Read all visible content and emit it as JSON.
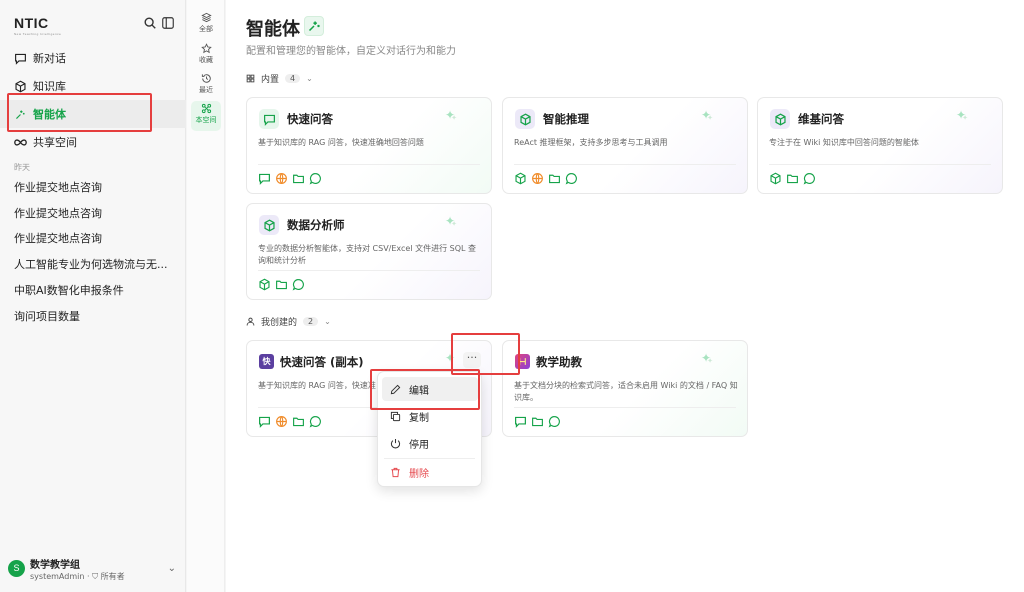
{
  "app": {
    "logo": "NTIC",
    "logo_tagline": "New Teaching Intelligence"
  },
  "sidebar": {
    "nav": [
      {
        "label": "新对话",
        "icon": "chat-bubble-icon"
      },
      {
        "label": "知识库",
        "icon": "cube-icon"
      },
      {
        "label": "智能体",
        "icon": "sparkle-icon",
        "active": true
      },
      {
        "label": "共享空间",
        "icon": "infinity-icon"
      }
    ],
    "section_label": "昨天",
    "history": [
      "作业提交地点咨询",
      "作业提交地点咨询",
      "作业提交地点咨询",
      "人工智能专业为何选物流与无...",
      "中职AI数智化申报条件",
      "询问项目数量"
    ],
    "user": {
      "avatar": "S",
      "org": "数学教学组",
      "account": "systemAdmin",
      "role": "所有者"
    }
  },
  "rail": [
    {
      "label": "全部",
      "icon": "layers-icon"
    },
    {
      "label": "收藏",
      "icon": "star-icon"
    },
    {
      "label": "最近",
      "icon": "history-icon"
    },
    {
      "label": "本空间",
      "icon": "network-icon",
      "active": true
    }
  ],
  "main": {
    "title": "智能体",
    "subtitle": "配置和管理您的智能体，自定义对话行为和能力",
    "groups": [
      {
        "label": "内置",
        "count": "4"
      },
      {
        "label": "我创建的",
        "count": "2"
      }
    ],
    "cards": [
      {
        "title": "快速问答",
        "desc": "基于知识库的 RAG 问答，快速准确地回答问题",
        "icon": "chat-icon",
        "tools": [
          "chat",
          "globe",
          "folder",
          "bubble"
        ]
      },
      {
        "title": "智能推理",
        "desc": "ReAct 推理框架，支持多步思考与工具调用",
        "icon": "cube-icon",
        "tools": [
          "cube",
          "globe",
          "folder",
          "bubble"
        ]
      },
      {
        "title": "维基问答",
        "desc": "专注于在 Wiki 知识库中回答问题的智能体",
        "icon": "cube-icon",
        "tools": [
          "cube",
          "folder",
          "bubble"
        ]
      },
      {
        "title": "数据分析师",
        "desc": "专业的数据分析智能体，支持对 CSV/Excel 文件进行 SQL 查询和统计分析",
        "icon": "cube-icon",
        "tools": [
          "cube",
          "folder",
          "bubble"
        ]
      },
      {
        "title": "快速问答 (副本)",
        "desc": "基于知识库的 RAG 问答，快速准",
        "icon": "badge-kuai",
        "badge": "快",
        "tools": [
          "chat",
          "globe",
          "folder",
          "bubble"
        ]
      },
      {
        "title": "教学助教",
        "desc": "基于文档分块的检索式问答，适合未启用 Wiki 的文档 / FAQ 知识库。",
        "icon": "badge-book",
        "tools": [
          "chat",
          "folder",
          "bubble"
        ]
      }
    ],
    "context_menu": {
      "items": [
        {
          "label": "编辑",
          "icon": "pencil-icon"
        },
        {
          "label": "复制",
          "icon": "copy-icon"
        },
        {
          "label": "停用",
          "icon": "power-icon"
        },
        {
          "label": "删除",
          "icon": "trash-icon"
        }
      ]
    },
    "more_label": "···"
  },
  "colors": {
    "accent": "#16a34a",
    "danger": "#e53e3e",
    "purple_badge": "#5b3fa0"
  }
}
